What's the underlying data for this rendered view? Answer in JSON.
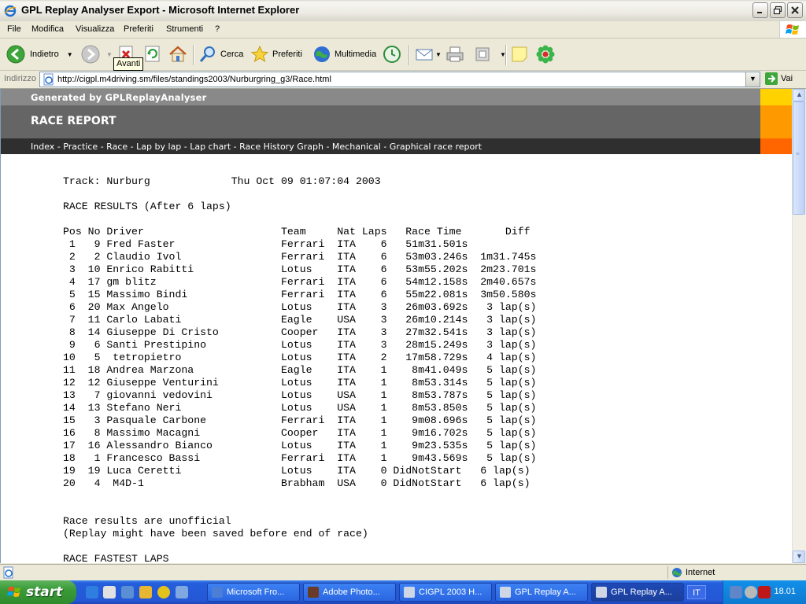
{
  "window": {
    "title": "GPL Replay Analyser Export - Microsoft Internet Explorer"
  },
  "menu": [
    "File",
    "Modifica",
    "Visualizza",
    "Preferiti",
    "Strumenti",
    "?"
  ],
  "toolbar": {
    "back_label": "Indietro",
    "forward_tooltip": "Avanti",
    "search_label": "Cerca",
    "favorites_label": "Preferiti",
    "media_label": "Multimedia"
  },
  "address": {
    "label": "Indirizzo",
    "url": "http://cigpl.m4driving.sm/files/standings2003/Nurburgring_g3/Race.html",
    "go_label": "Vai"
  },
  "page": {
    "generated_by": "Generated by GPLReplayAnalyser",
    "report_title": "RACE REPORT",
    "nav_links": [
      "Index",
      "Practice",
      "Race",
      "Lap by lap",
      "Lap chart",
      "Race History Graph",
      "Mechanical",
      "Graphical race report"
    ],
    "nav_separator": " - ",
    "header_swatches": [
      "#ffd200",
      "#ff9900",
      "#ff6600"
    ],
    "report_text": "Track: Nurburg             Thu Oct 09 01:07:04 2003\n\nRACE RESULTS (After 6 laps)\n\nPos No Driver                      Team     Nat Laps   Race Time       Diff\n 1   9 Fred Faster                 Ferrari  ITA    6   51m31.501s\n 2   2 Claudio Ivol                Ferrari  ITA    6   53m03.246s  1m31.745s\n 3  10 Enrico Rabitti              Lotus    ITA    6   53m55.202s  2m23.701s\n 4  17 gm blitz                    Ferrari  ITA    6   54m12.158s  2m40.657s\n 5  15 Massimo Bindi               Ferrari  ITA    6   55m22.081s  3m50.580s\n 6  20 Max Angelo                  Lotus    ITA    3   26m03.692s   3 lap(s)\n 7  11 Carlo Labati                Eagle    USA    3   26m10.214s   3 lap(s)\n 8  14 Giuseppe Di Cristo          Cooper   ITA    3   27m32.541s   3 lap(s)\n 9   6 Santi Prestipino            Lotus    ITA    3   28m15.249s   3 lap(s)\n10   5  tetropietro                Lotus    ITA    2   17m58.729s   4 lap(s)\n11  18 Andrea Marzona              Eagle    ITA    1    8m41.049s   5 lap(s)\n12  12 Giuseppe Venturini          Lotus    ITA    1    8m53.314s   5 lap(s)\n13   7 giovanni vedovini           Lotus    USA    1    8m53.787s   5 lap(s)\n14  13 Stefano Neri                Lotus    USA    1    8m53.850s   5 lap(s)\n15   3 Pasquale Carbone            Ferrari  ITA    1    9m08.696s   5 lap(s)\n16   8 Massimo Macagni             Cooper   ITA    1    9m16.702s   5 lap(s)\n17  16 Alessandro Bianco           Lotus    ITA    1    9m23.535s   5 lap(s)\n18   1 Francesco Bassi             Ferrari  ITA    1    9m43.569s   5 lap(s)\n19  19 Luca Ceretti                Lotus    ITA    0 DidNotStart   6 lap(s)\n20   4  M4D-1                      Brabham  USA    0 DidNotStart   6 lap(s)\n\n\nRace results are unofficial\n(Replay might have been saved before end of race)\n\nRACE FASTEST LAPS"
  },
  "status": {
    "zone": "Internet"
  },
  "taskbar": {
    "start_label": "start",
    "tasks": [
      "Microsoft Fro...",
      "Adobe Photo...",
      "CIGPL 2003 H...",
      "GPL Replay A...",
      "GPL Replay A..."
    ],
    "language": "IT",
    "clock": "18.01"
  },
  "colors": {
    "header_light": "#898989",
    "header_mid": "#656565",
    "header_dark": "#2f2f2f",
    "xp_taskbar": "#245edb",
    "start_green": "#3a9a38"
  }
}
